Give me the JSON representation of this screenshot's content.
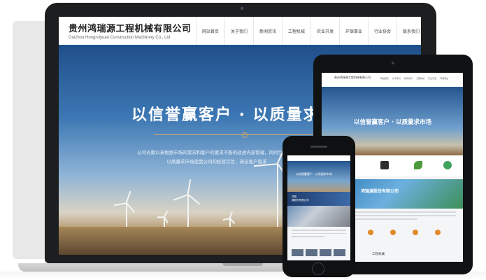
{
  "site": {
    "brand_cn": "贵州鸿瑞源工程机械有限公司",
    "brand_en": "Guizhou Hongruiyuan Construction Machinery Co., Ltd",
    "nav": [
      "网站首页",
      "关于我们",
      "新闻资讯",
      "工程机械",
      "农业开发",
      "环保事业",
      "行业协会",
      "联系我们"
    ]
  },
  "hero": {
    "title": "以信誉赢客户 · 以质量求",
    "lines": [
      "公司长期以来根据市场的需求和客户的要求不断的改进内部管理，同时引进高素",
      "以质量求市场是我公司的经营宗旨，满足客户需求"
    ]
  },
  "tablet": {
    "hero_title": "以信誉赢客户 · 以质量求市场",
    "banner_title": "鸿瑞源股份有限公司",
    "section_title": "工程机械"
  },
  "phone": {
    "hero_title": "以信誉赢客户 · 以质量求市场",
    "band_lines": [
      "鸿瑞",
      "源股份有限公司"
    ]
  },
  "colors": {
    "accent_gold": "#c9a868",
    "sky_blue": "#3d78b4",
    "nav_text": "#444444"
  }
}
